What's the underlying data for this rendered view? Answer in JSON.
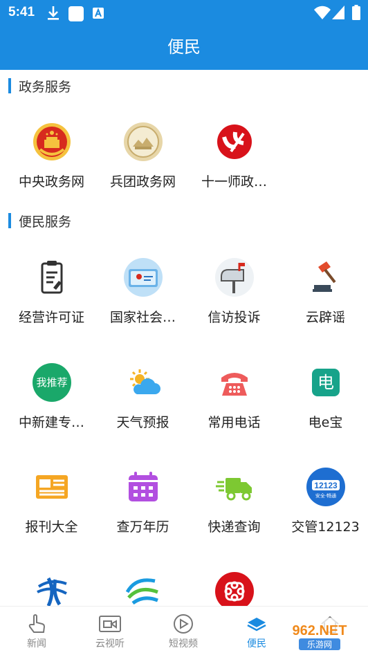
{
  "status": {
    "time": "5:41"
  },
  "header": {
    "title": "便民"
  },
  "sections": [
    {
      "title": "政务服务",
      "items": [
        {
          "label": "中央政务网"
        },
        {
          "label": "兵团政务网"
        },
        {
          "label": "十一师政…"
        }
      ]
    },
    {
      "title": "便民服务",
      "items": [
        {
          "label": "经营许可证"
        },
        {
          "label": "国家社会…"
        },
        {
          "label": "信访投诉"
        },
        {
          "label": "云辟谣"
        },
        {
          "label": "中新建专…"
        },
        {
          "label": "天气预报"
        },
        {
          "label": "常用电话"
        },
        {
          "label": "电e宝"
        },
        {
          "label": "报刊大全"
        },
        {
          "label": "查万年历"
        },
        {
          "label": "快递查询"
        },
        {
          "label": "交管12123"
        }
      ]
    }
  ],
  "icon_texts": {
    "emblem_12123": "12123",
    "emblem_12123_sub": "安全·畅通",
    "dianebao": "电",
    "zhongxinjian": "我推荐"
  },
  "tabs": [
    {
      "label": "新闻"
    },
    {
      "label": "云视听"
    },
    {
      "label": "短视频"
    },
    {
      "label": "便民"
    },
    {
      "label": ""
    }
  ],
  "watermark": {
    "main": "962.NET",
    "sub": "乐游网"
  },
  "colors": {
    "accent": "#1b8be0",
    "tab_inactive": "#888888"
  }
}
